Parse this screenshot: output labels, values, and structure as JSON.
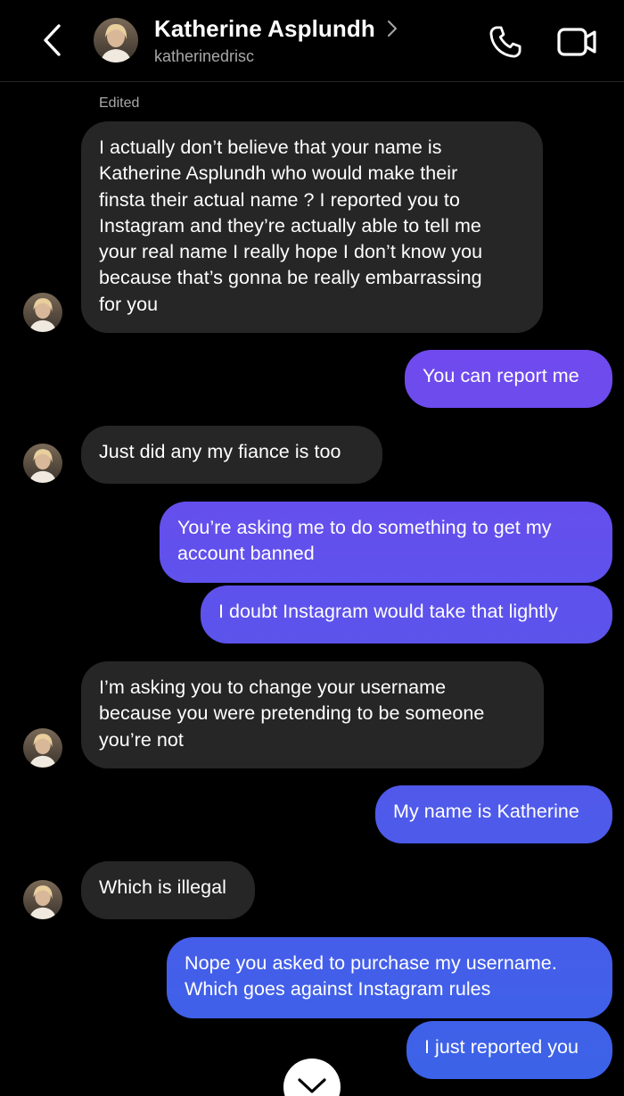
{
  "header": {
    "name": "Katherine Asplundh",
    "username": "katherinedrisc",
    "icons": {
      "back": "chevron-left-icon",
      "profile": "chevron-right-icon",
      "call": "phone-icon",
      "video": "video-camera-icon"
    }
  },
  "colors": {
    "background": "#000000",
    "incoming_bubble": "#262626",
    "outgoing_gradient_top": "#8a3ef0",
    "outgoing_gradient_bottom": "#3a63e8",
    "secondary_text": "#a8a8a8"
  },
  "thread": {
    "edited_label": "Edited",
    "messages": [
      {
        "side": "in",
        "lines": [
          "I actually don’t believe that your name is",
          "Katherine Asplundh who would make their",
          "finsta their actual name ? I reported you to",
          "Instagram and they’re actually able to tell me",
          "your real name I really hope I don’t know you",
          "because that’s gonna be really embarrassing",
          "for you"
        ]
      },
      {
        "side": "out",
        "lines": [
          "You can report me"
        ]
      },
      {
        "side": "in",
        "lines": [
          "Just did any my fiance is too"
        ]
      },
      {
        "side": "out",
        "lines": [
          "You’re asking me to do something to get my",
          "account banned"
        ]
      },
      {
        "side": "out",
        "lines": [
          "I doubt Instagram would take that lightly"
        ]
      },
      {
        "side": "in",
        "lines": [
          "I’m asking you to change your username",
          "because you were pretending to be someone",
          "you’re not"
        ]
      },
      {
        "side": "out",
        "lines": [
          "My name is Katherine"
        ]
      },
      {
        "side": "in",
        "lines": [
          "Which is illegal"
        ]
      },
      {
        "side": "out",
        "lines": [
          "Nope you asked to purchase my username.",
          "Which goes against Instagram rules"
        ]
      },
      {
        "side": "out",
        "lines": [
          "I just reported you"
        ]
      }
    ]
  },
  "scroll_button": {
    "icon": "chevron-down-icon"
  }
}
